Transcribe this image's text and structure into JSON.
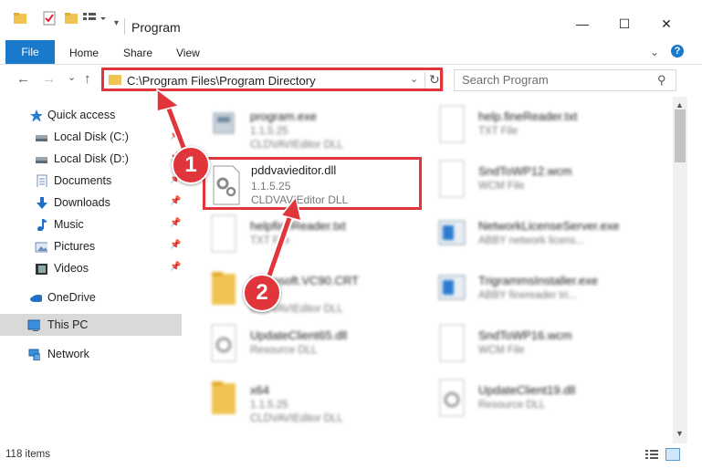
{
  "window": {
    "title": "Program",
    "controls": {
      "minimize": "—",
      "maximize": "☐",
      "close": "✕"
    }
  },
  "ribbon": {
    "tabs": [
      "File",
      "Home",
      "Share",
      "View"
    ],
    "help": "?"
  },
  "nav": {
    "back": "←",
    "forward": "→",
    "recent": "⌄",
    "up": "↑",
    "address": "C:\\Program Files\\Program Directory",
    "search_placeholder": "Search Program"
  },
  "sidebar": {
    "quick_access": "Quick access",
    "items": [
      {
        "label": "Local Disk (C:)",
        "icon": "drive-icon",
        "pinned": true
      },
      {
        "label": "Local Disk (D:)",
        "icon": "drive-icon",
        "pinned": true
      },
      {
        "label": "Documents",
        "icon": "documents-icon",
        "pinned": true
      },
      {
        "label": "Downloads",
        "icon": "downloads-icon",
        "pinned": true
      },
      {
        "label": "Music",
        "icon": "music-icon",
        "pinned": true
      },
      {
        "label": "Pictures",
        "icon": "pictures-icon",
        "pinned": true
      },
      {
        "label": "Videos",
        "icon": "videos-icon",
        "pinned": true
      }
    ],
    "onedrive": "OneDrive",
    "this_pc": "This PC",
    "network": "Network"
  },
  "files": {
    "left": [
      {
        "name": "program.exe",
        "line1": "1.1.5.25",
        "line2": "CLDVAVIEditor DLL",
        "icon": "exe-icon"
      },
      {
        "name": "helpfineReader.txt",
        "line1": "TXT File",
        "line2": "",
        "icon": "text-file-icon"
      },
      {
        "name": "Microsoft.VC90.CRT",
        "line1": "",
        "line2": "CLDVAVIEditor DLL",
        "icon": "folder-icon"
      },
      {
        "name": "UpdateClient65.dll",
        "line1": "Resource DLL",
        "line2": "",
        "icon": "dll-icon"
      },
      {
        "name": "x64",
        "line1": "1.1.5.25",
        "line2": "CLDVAVIEditor DLL",
        "icon": "folder-icon"
      }
    ],
    "right": [
      {
        "name": "help.fineReader.txt",
        "line1": "TXT File",
        "icon": "text-file-icon"
      },
      {
        "name": "SndToWP12.wcm",
        "line1": "WCM File",
        "icon": "text-file-icon"
      },
      {
        "name": "NetworkLicenseServer.exe",
        "line1": "ABBY network licens...",
        "icon": "app-icon"
      },
      {
        "name": "TrigrammsInstaller.exe",
        "line1": "ABBY finereader tri...",
        "icon": "app-icon"
      },
      {
        "name": "SndToWP16.wcm",
        "line1": "WCM File",
        "icon": "text-file-icon"
      },
      {
        "name": "UpdateClient19.dll",
        "line1": "Resource DLL",
        "icon": "dll-icon"
      }
    ],
    "selected": {
      "name": "pddvavieditor.dll",
      "line1": "1.1.5.25",
      "line2": "CLDVAVIEditor DLL",
      "icon": "dll-gear-icon"
    }
  },
  "annotations": {
    "step1": "1",
    "step2": "2"
  },
  "status": {
    "count": "118 items"
  },
  "colors": {
    "accent": "#1979ca",
    "highlight": "#e0353a",
    "folder": "#f0c452"
  }
}
